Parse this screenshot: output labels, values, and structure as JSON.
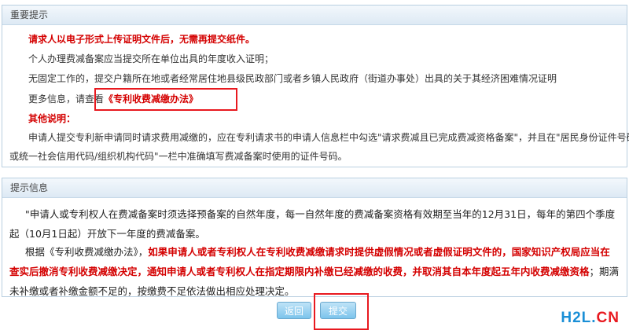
{
  "notice": {
    "title": "重要提示",
    "line1": "请求人以电子形式上传证明文件后，无需再提交纸件。",
    "line2": "个人办理费减备案应当提交所在单位出具的年度收入证明；",
    "line3": "无固定工作的，提交户籍所在地或者经常居住地县级民政部门或者乡镇人民政府（街道办事处）出具的关于其经济困难情况证明",
    "more_prefix": "更多信息，请查看",
    "more_link": "《专利收费减缴办法》",
    "other_title": "其他说明：",
    "other_line1": "申请人提交专利新申请同时请求费用减缴的，应在专利请求书的申请人信息栏中勾选\"请求费减且已完成费减资格备案\"，并且在\"居民身份证件号码",
    "other_line2": "或统一社会信用代码/组织机构代码\"一栏中准确填写费减备案时使用的证件号码。"
  },
  "info": {
    "title": "提示信息",
    "para1": "\"申请人或专利权人在费减备案时须选择预备案的自然年度，每一自然年度的费减备案资格有效期至当年的12月31日，每年的第四个季度起（10月1日起）开放下一年度的费减备案。",
    "para2_prefix": "根据《专利收费减缴办法》，",
    "para2_red": "如果申请人或者专利权人在专利收费减缴请求时提供虚假情况或者虚假证明文件的，国家知识产权局应当在查实后撤消专利收费减缴决定，通知申请人或者专利权人在指定期限内补缴已经减缴的收费，并取消其自本年度起五年内收费减缴资格",
    "para2_suffix": "；期满未补缴或者补缴金额不足的，按缴费不足依法做出相应处理决定。"
  },
  "actions": {
    "back_label": "返回",
    "submit_label": "提交"
  },
  "watermark": {
    "h2l": "H2L",
    "dot": ".",
    "cn": "CN",
    "colors": {
      "h2l": "#1a8fd6",
      "cn": "#e8191f"
    }
  }
}
